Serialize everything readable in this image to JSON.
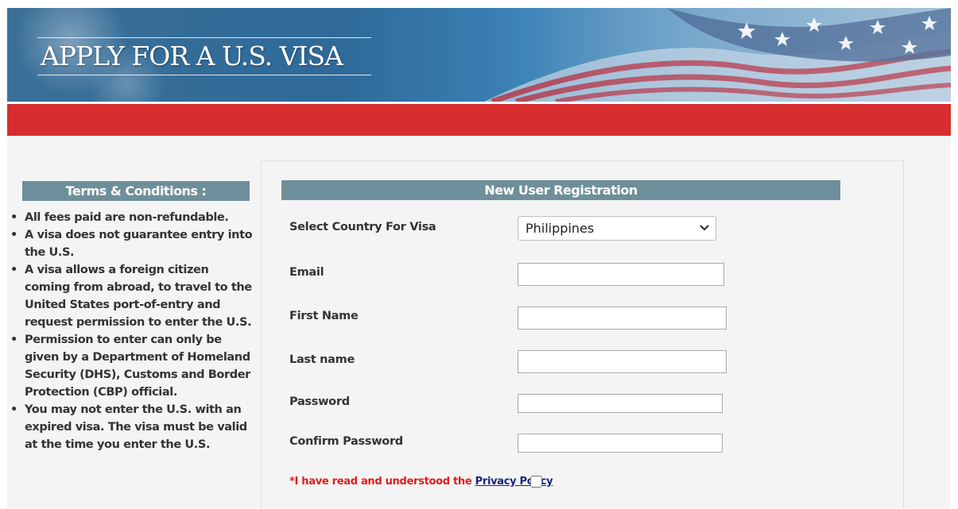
{
  "banner": {
    "title": "APPLY FOR A U.S. VISA"
  },
  "terms": {
    "header": "Terms & Conditions :",
    "items": [
      "All fees paid are non-refundable.",
      "A visa does not guarantee entry into the U.S.",
      "A visa allows a foreign citizen coming from abroad, to travel to the United States port-of-entry and request permission to enter the U.S.",
      "Permission to enter can only be given by a Department of Homeland Security (DHS), Customs and Border Protection (CBP) official.",
      "You may not enter the U.S. with an expired visa. The visa must be valid at the time you enter the U.S."
    ]
  },
  "registration": {
    "header": "New User Registration",
    "country_label": "Select Country For Visa",
    "country_value": "Philippines",
    "email_label": "Email",
    "email_value": "",
    "first_name_label": "First Name",
    "first_name_value": "",
    "last_name_label": "Last name",
    "last_name_value": "",
    "password_label": "Password",
    "password_value": "",
    "confirm_password_label": "Confirm Password",
    "confirm_password_value": "",
    "privacy_prefix": "*I have read and understood the",
    "privacy_link": "Privacy Policy",
    "privacy_checked": false
  },
  "colors": {
    "red_bar": "#d72d2f",
    "header_bar": "#6e8f9a",
    "privacy_text": "#e01c1c",
    "link": "#1a237e"
  },
  "icons": {
    "select_arrow": "chevron-down-icon"
  }
}
